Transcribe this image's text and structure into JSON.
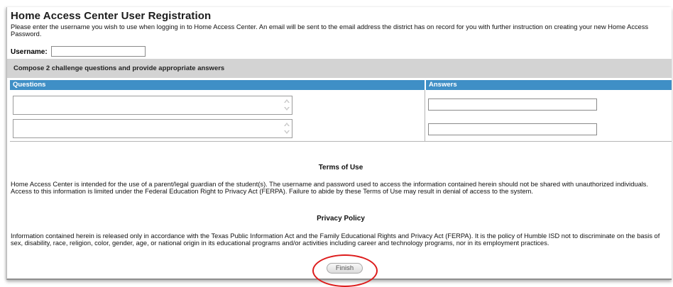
{
  "page": {
    "title": "Home Access Center User Registration",
    "intro": "Please enter the username you wish to use when logging in to Home Access Center. An email will be sent to the email address the district has on record for you with further instruction on creating your new Home Access Password."
  },
  "username": {
    "label": "Username:",
    "value": ""
  },
  "challenge": {
    "heading": "Compose 2 challenge questions and provide appropriate answers",
    "questions_header": "Questions",
    "answers_header": "Answers",
    "questions": [
      "",
      ""
    ],
    "answers": [
      "",
      ""
    ]
  },
  "terms": {
    "heading": "Terms of Use",
    "body": "Home Access Center is intended for the use of a parent/legal guardian of the student(s). The username and password used to access the information contained herein should not be shared with unauthorized individuals. Access to this information is limited under the Federal Education Right to Privacy Act (FERPA). Failure to abide by these Terms of Use may result in denial of access to the system."
  },
  "privacy": {
    "heading": "Privacy Policy",
    "body": "Information contained herein is released only in accordance with the Texas Public Information Act and the Family Educational Rights and Privacy Act (FERPA). It is the policy of Humble ISD not to discriminate on the basis of sex, disability, race, religion, color, gender, age, or national origin in its educational programs and/or activities including career and technology programs, nor in its employment practices."
  },
  "actions": {
    "finish_label": "Finish"
  },
  "colors": {
    "header_blue": "#3f8fc6",
    "compose_gray": "#d3d3d3",
    "highlight_red": "#dd1b1b"
  }
}
